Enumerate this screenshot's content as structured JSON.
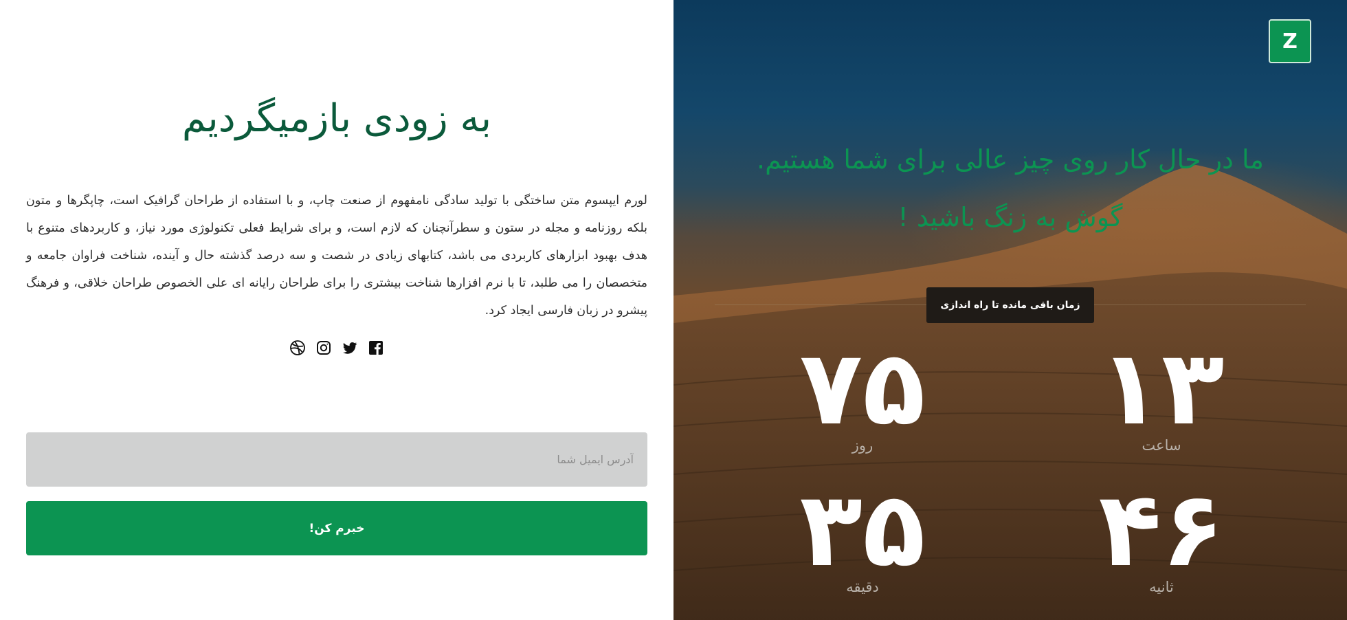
{
  "left": {
    "title": "به زودی بازمیگردیم",
    "description": "لورم ایپسوم متن ساختگی با تولید سادگی نامفهوم از صنعت چاپ، و با استفاده از طراحان گرافیک است، چاپگرها و متون بلکه روزنامه و مجله در ستون و سطرآنچنان که لازم است، و برای شرایط فعلی تکنولوژی مورد نیاز، و کاربردهای متنوع با هدف بهبود ابزارهای کاربردی می باشد، کتابهای زیادی در شصت و سه درصد گذشته حال و آینده، شناخت فراوان جامعه و متخصصان را می طلبد، تا با نرم افزارها شناخت بیشتری را برای طراحان رایانه ای علی الخصوص طراحان خلاقی، و فرهنگ پیشرو در زبان فارسی ایجاد کرد.",
    "social_icons": [
      "dribbble-icon",
      "instagram-icon",
      "twitter-icon",
      "facebook-icon"
    ],
    "email": {
      "placeholder": "آدرس ایمیل شما",
      "value": ""
    },
    "submit_label": "خبرم کن!"
  },
  "right": {
    "logo": "Z",
    "headline_line1": "ما در حال کار روی چیز عالی برای شما هستیم.",
    "headline_line2": "گوش به زنگ باشید !",
    "countdown_label": "زمان باقی مانده تا راه اندازی",
    "countdown": {
      "days": {
        "value": "۷۵",
        "label": "روز"
      },
      "hours": {
        "value": "۱۳",
        "label": "ساعت"
      },
      "minutes": {
        "value": "۳۵",
        "label": "دقیقه"
      },
      "seconds": {
        "value": "۴۶",
        "label": "ثانیه"
      }
    }
  },
  "colors": {
    "primary_green": "#0c9452",
    "title_green": "#0b5a3b",
    "input_bg": "#d0d1d1",
    "countdown_label_bg": "#1f1b17"
  }
}
